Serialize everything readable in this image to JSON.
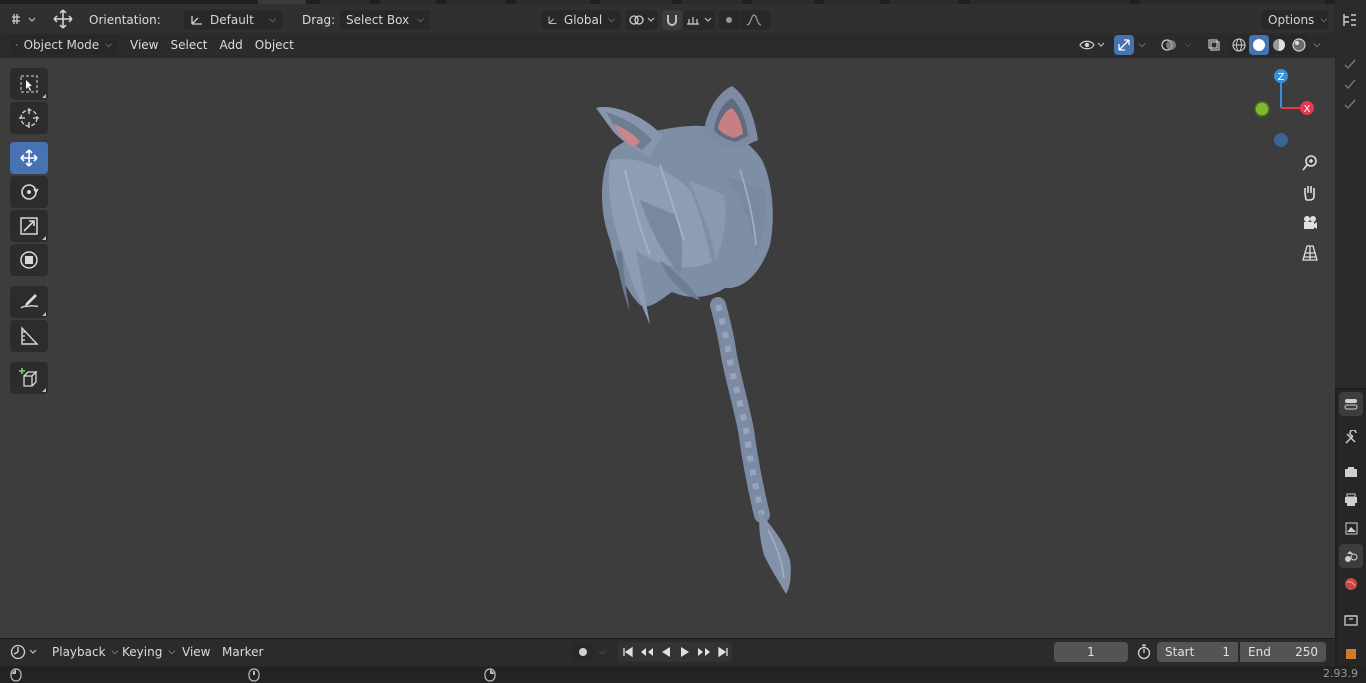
{
  "header": {
    "orientation_label": "Orientation:",
    "orientation_value": "Default",
    "drag_label": "Drag:",
    "drag_value": "Select Box",
    "transform_space": "Global",
    "options_label": "Options"
  },
  "viewport_header": {
    "mode": "Object Mode",
    "menus": [
      "View",
      "Select",
      "Add",
      "Object"
    ]
  },
  "gizmo": {
    "z_label": "Z",
    "x_label": "X",
    "colors": {
      "x": "#e8384f",
      "y": "#7fb82e",
      "z": "#3a8fd8"
    }
  },
  "toolbar": {
    "tools": [
      "select-box-icon",
      "cursor-icon",
      "move-icon",
      "rotate-icon",
      "scale-icon",
      "transform-icon",
      "annotate-icon",
      "measure-icon",
      "add-cube-icon"
    ],
    "active_tool": "move-icon"
  },
  "nav_gizmos": [
    "zoom-icon",
    "hand-pan-icon",
    "camera-icon",
    "grid-perspective-icon"
  ],
  "timeline": {
    "menus": [
      "Playback",
      "Keying",
      "View",
      "Marker"
    ],
    "current_frame": "1",
    "start_label": "Start",
    "start_value": "1",
    "end_label": "End",
    "end_value": "250"
  },
  "status": {
    "version": "2.93.9"
  },
  "colors": {
    "accent": "#4772b3",
    "viewport_bg": "#3d3d3d",
    "model": "#8696ad",
    "ear_inner": "#c97f83"
  }
}
